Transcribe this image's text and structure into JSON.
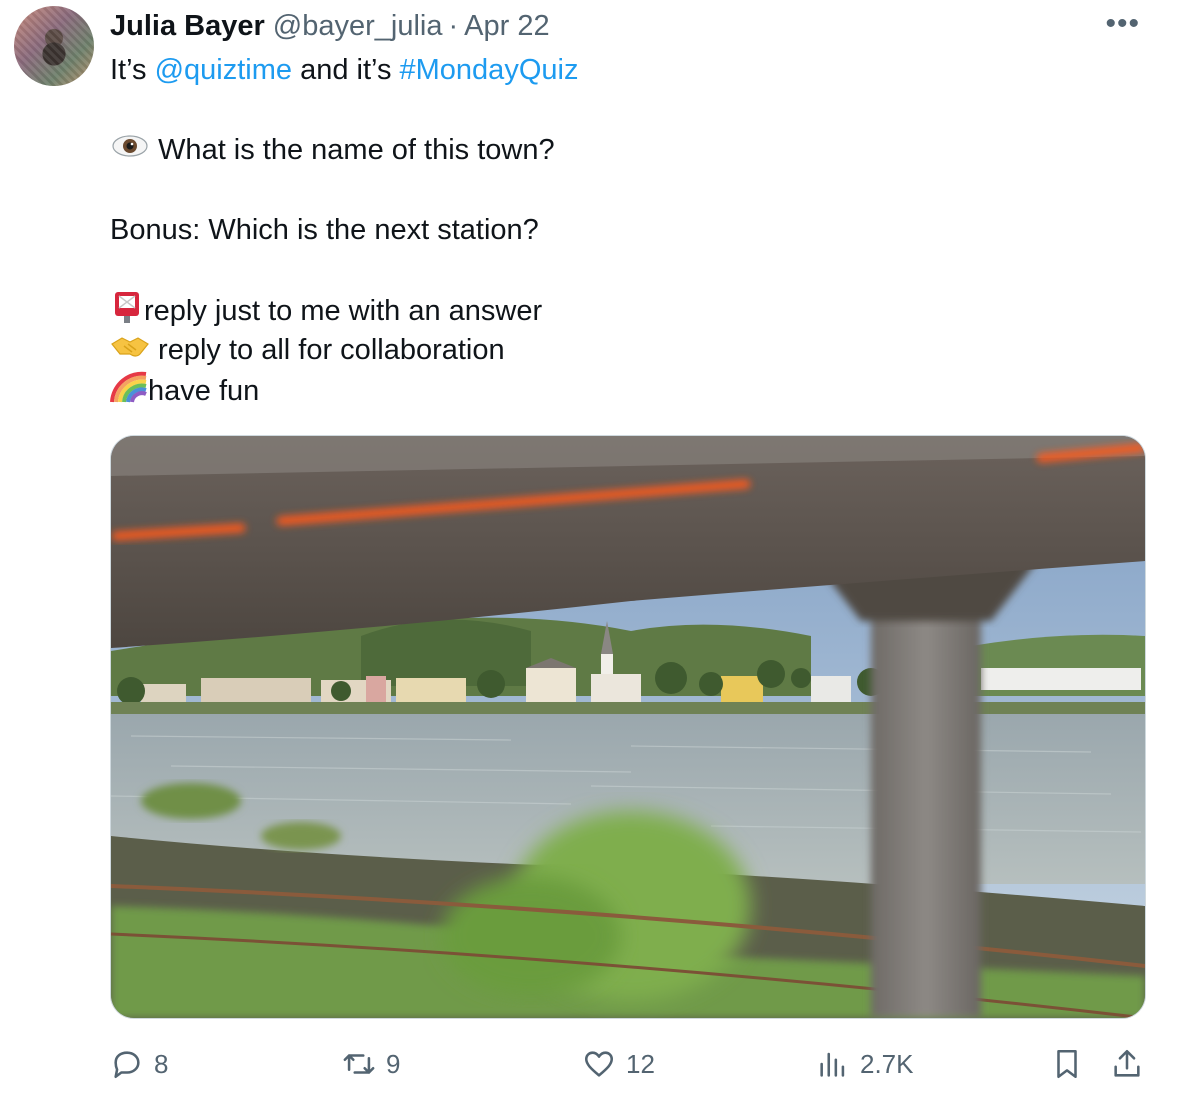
{
  "user": {
    "display_name": "Julia Bayer",
    "handle": "@bayer_julia",
    "separator": "·",
    "date": "Apr 22"
  },
  "more_icon": "more-horizontal-icon",
  "tweet": {
    "line1_prefix": "It’s ",
    "mention": "@quiztime",
    "line1_middle": " and it’s ",
    "hashtag": "#MondayQuiz",
    "question": "What is the name of this town?",
    "bonus": "Bonus: Which is the next station?",
    "reply_private": "reply just to me with an answer",
    "reply_all": " reply to all for collaboration",
    "have_fun": "have fun"
  },
  "emojis": [
    "eye-emoji",
    "postbox-emoji",
    "handshake-emoji",
    "rainbow-emoji"
  ],
  "media": {
    "alt": "Blurred view from a train passing under a concrete bridge along a river, with a riverside town, white church tower and green hills on the far bank"
  },
  "actions": {
    "replies": "8",
    "reposts": "9",
    "likes": "12",
    "views": "2.7K"
  },
  "colors": {
    "link": "#1d9bf0",
    "secondary_text": "#536471",
    "bridge_stripe": "#ff5a1f"
  }
}
